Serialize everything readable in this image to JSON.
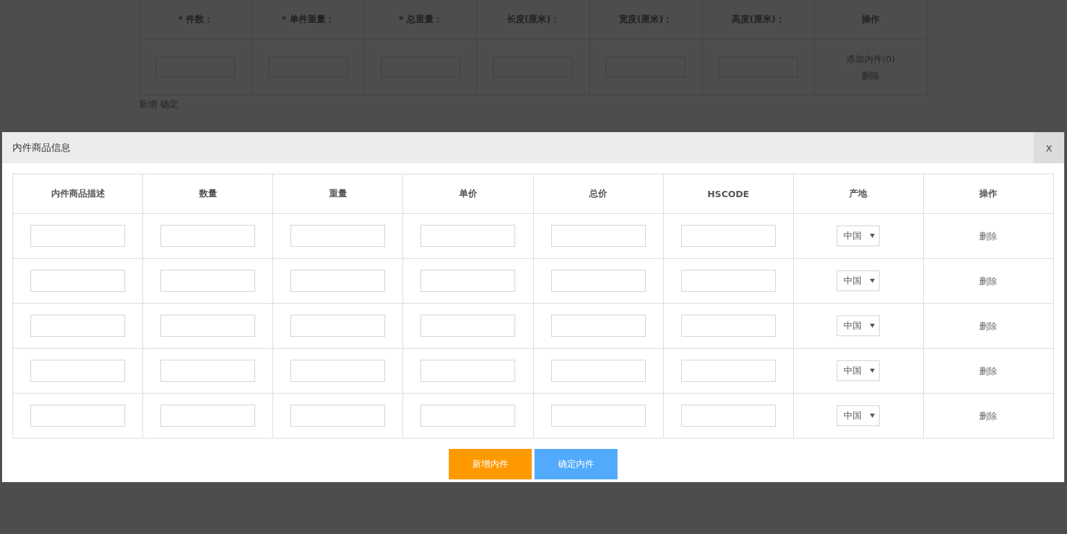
{
  "background_form": {
    "columns": [
      {
        "label": "* 件数：",
        "kind": "input"
      },
      {
        "label": "* 单件重量：",
        "kind": "input"
      },
      {
        "label": "* 总重量：",
        "kind": "input"
      },
      {
        "label": "长度(厘米)：",
        "kind": "input"
      },
      {
        "label": "宽度(厘米)：",
        "kind": "input"
      },
      {
        "label": "高度(厘米)：",
        "kind": "input"
      },
      {
        "label": "操作",
        "kind": "actions"
      }
    ],
    "row_actions": [
      "添加内件(0)",
      "删除"
    ],
    "links": [
      "新增",
      "确定"
    ]
  },
  "dialog": {
    "title": "内件商品信息",
    "close": "x",
    "columns": [
      {
        "label": "内件商品描述",
        "kind": "input"
      },
      {
        "label": "数量",
        "kind": "input"
      },
      {
        "label": "重量",
        "kind": "input"
      },
      {
        "label": "单价",
        "kind": "input"
      },
      {
        "label": "总价",
        "kind": "input"
      },
      {
        "label": "HSCODE",
        "kind": "input"
      },
      {
        "label": "产地",
        "kind": "select"
      },
      {
        "label": "操作",
        "kind": "action"
      }
    ],
    "rows": [
      {
        "origin": "中国",
        "action": "删除"
      },
      {
        "origin": "中国",
        "action": "删除"
      },
      {
        "origin": "中国",
        "action": "删除"
      },
      {
        "origin": "中国",
        "action": "删除"
      },
      {
        "origin": "中国",
        "action": "删除"
      }
    ],
    "buttons": [
      {
        "label": "新增内件",
        "kind": "add"
      },
      {
        "label": "确定内件",
        "kind": "confirm"
      }
    ]
  }
}
